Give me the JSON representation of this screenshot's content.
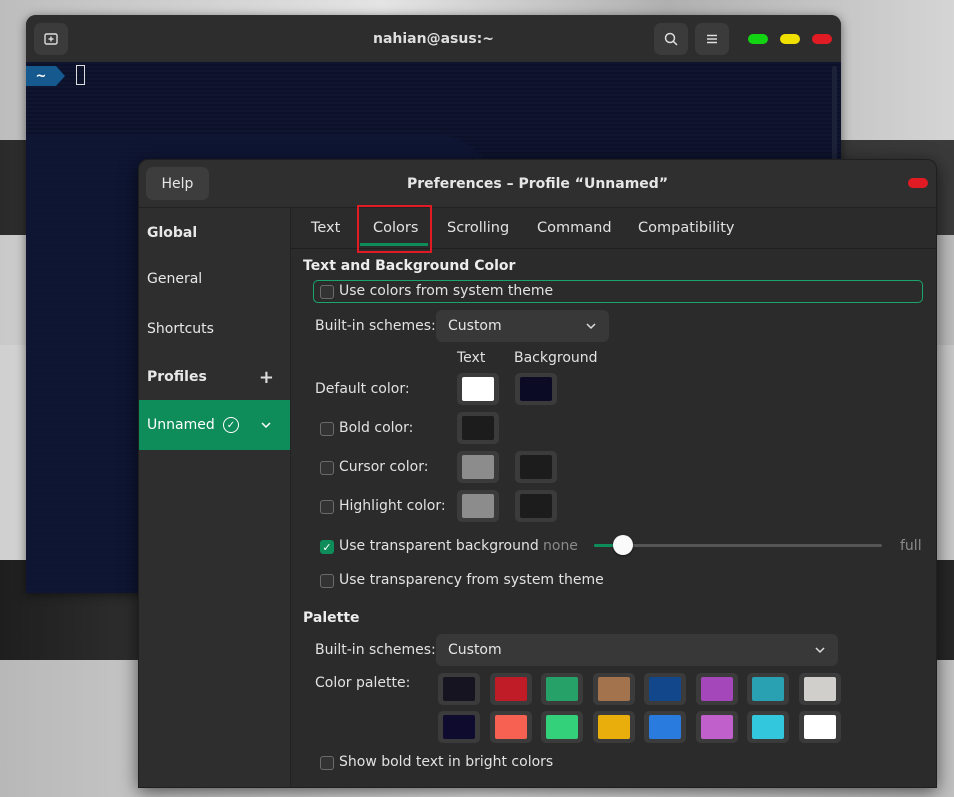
{
  "terminal": {
    "title": "nahian@asus:~",
    "prompt": "~",
    "controls": {
      "green": "#13d413",
      "yellow": "#f0e000",
      "red": "#e01b24"
    }
  },
  "prefs": {
    "title": "Preferences – Profile “Unnamed”",
    "help": "Help",
    "sidebar": {
      "global": "Global",
      "general": "General",
      "shortcuts": "Shortcuts",
      "profiles": "Profiles",
      "profile_name": "Unnamed"
    },
    "tabs": [
      "Text",
      "Colors",
      "Scrolling",
      "Command",
      "Compatibility"
    ],
    "active_tab": "Colors",
    "colors": {
      "section_title": "Text and Background Color",
      "use_system_theme": "Use colors from system theme",
      "builtin_label": "Built-in schemes:",
      "builtin_value": "Custom",
      "col_text": "Text",
      "col_background": "Background",
      "default_color": "Default color:",
      "bold_color": "Bold color:",
      "cursor_color": "Cursor color:",
      "highlight_color": "Highlight color:",
      "transparent_bg": "Use transparent background",
      "slider_none": "none",
      "slider_full": "full",
      "transparency_level": 0.1,
      "transparency_system": "Use transparency from system theme",
      "swatches": {
        "default_text": "#ffffff",
        "default_bg": "#0b0b26",
        "bold_text": "#1c1c1c",
        "cursor_text": "#8c8c8c",
        "cursor_bg": "#1c1c1c",
        "highlight_text": "#8c8c8c",
        "highlight_bg": "#1c1c1c"
      }
    },
    "palette": {
      "section_title": "Palette",
      "builtin_label": "Built-in schemes:",
      "builtin_value": "Custom",
      "palette_label": "Color palette:",
      "row1": [
        "#171421",
        "#c01c28",
        "#26a269",
        "#a2734c",
        "#12488b",
        "#a347ba",
        "#2aa1b3",
        "#d0cfcc"
      ],
      "row2": [
        "#0e0b2e",
        "#f66151",
        "#33d17a",
        "#e9ad0c",
        "#2a7bde",
        "#c061cb",
        "#33c7de",
        "#ffffff"
      ],
      "bold_bright": "Show bold text in bright colors"
    }
  }
}
